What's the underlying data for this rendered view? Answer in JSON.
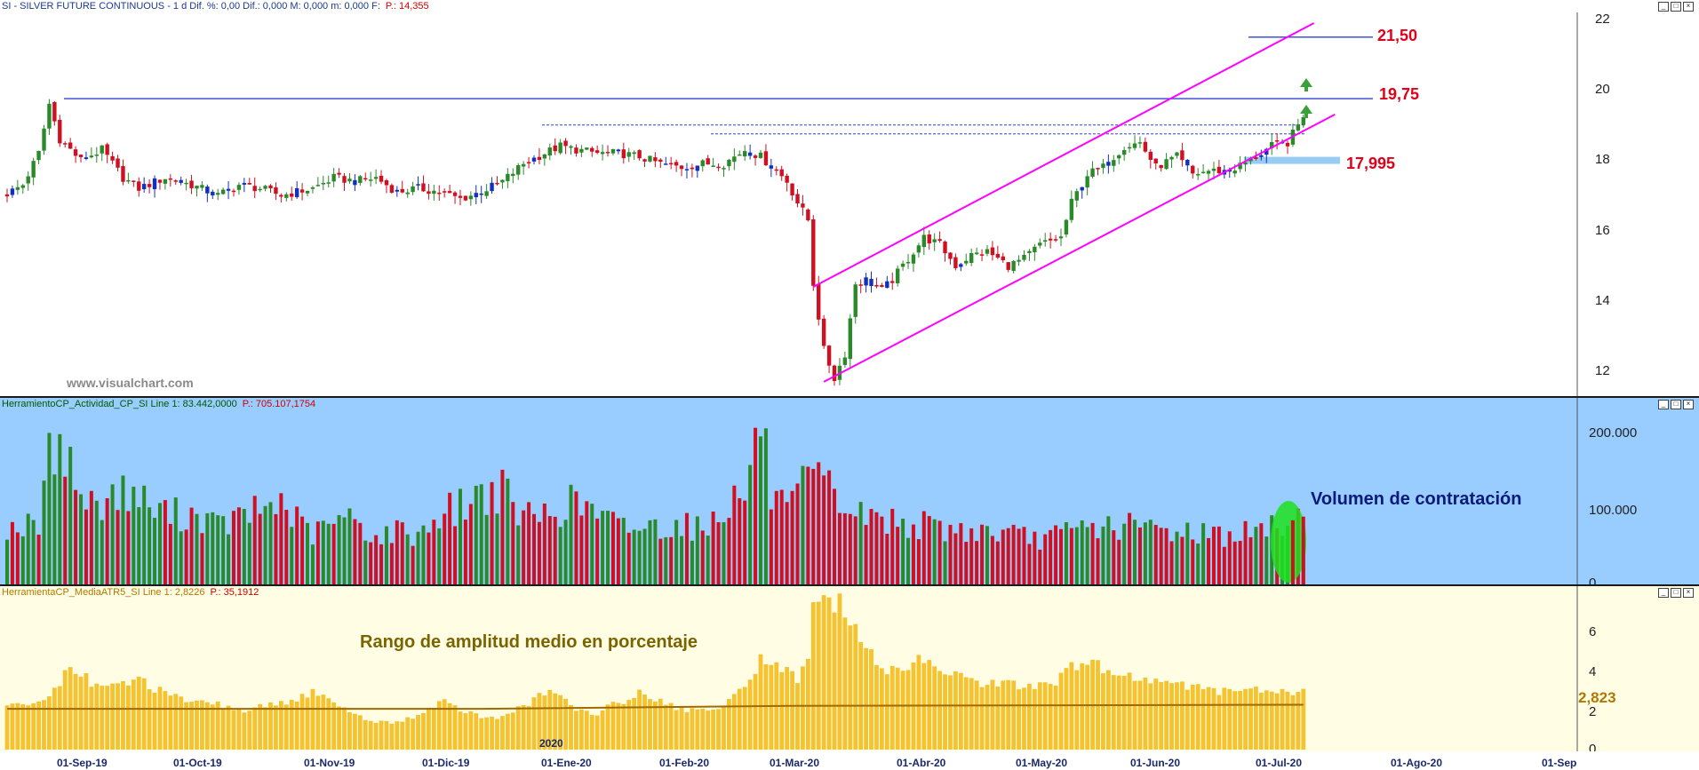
{
  "header": {
    "symbol_line": "SI - SILVER FUTURE CONTINUOUS -  1 d  Dif. %: 0,00  Dif.: 0,000  M: 0,000  m: 0,000  F:",
    "symbol_extra": "P.: 14,355"
  },
  "volume_panel": {
    "header": "HerramientoCP_Actividad_CP_SI  Line 1: 83.442,0000",
    "header_extra": "P.: 705.107,1754",
    "annotation": "Volumen de contratación",
    "axis": [
      "200.000",
      "100.000",
      "0"
    ]
  },
  "atr_panel": {
    "header": "HerramientaCP_MediaATR5_SI  Line 1: 2,8226",
    "header_extra": "P.: 35,1912",
    "annotation": "Rango de amplitud medio en porcentaje",
    "axis": [
      "6",
      "4",
      "2",
      "0"
    ],
    "last_value": "2,823"
  },
  "watermark": "www.visualchart.com",
  "price_axis": [
    "22",
    "20",
    "18",
    "16",
    "14",
    "12"
  ],
  "levels": {
    "resistance_high": "21,50",
    "resistance": "19,75",
    "support": "17,995"
  },
  "date_axis": [
    "01-Sep-19",
    "01-Oct-19",
    "01-Nov-19",
    "01-Dic-19",
    "01-Ene-20",
    "01-Feb-20",
    "01-Mar-20",
    "01-Abr-20",
    "01-May-20",
    "01-Jun-20",
    "01-Jul-20",
    "01-Ago-20",
    "01-Sep"
  ],
  "year_marker": "2020",
  "colors": {
    "up": "#2a8a2a",
    "down": "#d01020",
    "blue_candle": "#1030c0",
    "channel": "#ff00ff",
    "level_line": "#3040d0",
    "support_band": "#99ccf2",
    "atr_bar": "#f5c230",
    "atr_line": "#a06a00"
  },
  "chart_data": [
    {
      "type": "candlestick",
      "title": "SI - SILVER FUTURE CONTINUOUS",
      "ylim": [
        11.4,
        22.2
      ],
      "x": [
        "01-Sep-19",
        "01-Oct-19",
        "01-Nov-19",
        "01-Dic-19",
        "01-Ene-20",
        "01-Feb-20",
        "01-Mar-20",
        "01-Abr-20",
        "01-May-20",
        "01-Jun-20",
        "01-Jul-20"
      ],
      "close_path": [
        [
          0,
          17.05
        ],
        [
          3,
          17.3
        ],
        [
          6,
          18.2
        ],
        [
          8,
          19.6
        ],
        [
          10,
          18.6
        ],
        [
          14,
          18.0
        ],
        [
          18,
          18.3
        ],
        [
          22,
          17.5
        ],
        [
          25,
          17.2
        ],
        [
          30,
          17.5
        ],
        [
          35,
          17.3
        ],
        [
          40,
          17.0
        ],
        [
          44,
          17.3
        ],
        [
          48,
          17.2
        ],
        [
          52,
          17.0
        ],
        [
          58,
          17.2
        ],
        [
          62,
          17.5
        ],
        [
          66,
          17.4
        ],
        [
          70,
          17.5
        ],
        [
          74,
          17.1
        ],
        [
          78,
          17.2
        ],
        [
          82,
          17.1
        ],
        [
          86,
          16.9
        ],
        [
          90,
          17.1
        ],
        [
          94,
          17.4
        ],
        [
          98,
          17.9
        ],
        [
          102,
          18.2
        ],
        [
          105,
          18.4
        ],
        [
          108,
          18.3
        ],
        [
          112,
          18.2
        ],
        [
          116,
          18.2
        ],
        [
          120,
          18.1
        ],
        [
          124,
          17.9
        ],
        [
          128,
          17.8
        ],
        [
          132,
          17.9
        ],
        [
          136,
          17.9
        ],
        [
          140,
          18.3
        ],
        [
          143,
          18.1
        ],
        [
          146,
          17.7
        ],
        [
          148,
          17.4
        ],
        [
          150,
          16.8
        ],
        [
          152,
          16.3
        ],
        [
          153,
          14.5
        ],
        [
          155,
          12.6
        ],
        [
          157,
          11.8
        ],
        [
          159,
          12.5
        ],
        [
          161,
          14.5
        ],
        [
          163,
          14.6
        ],
        [
          166,
          14.3
        ],
        [
          168,
          14.6
        ],
        [
          171,
          15.2
        ],
        [
          174,
          15.8
        ],
        [
          177,
          15.6
        ],
        [
          180,
          15.0
        ],
        [
          183,
          15.3
        ],
        [
          186,
          15.4
        ],
        [
          190,
          15.0
        ],
        [
          193,
          15.2
        ],
        [
          196,
          15.6
        ],
        [
          200,
          15.8
        ],
        [
          202,
          16.8
        ],
        [
          205,
          17.6
        ],
        [
          208,
          17.8
        ],
        [
          212,
          18.4
        ],
        [
          215,
          18.5
        ],
        [
          218,
          17.8
        ],
        [
          222,
          18.1
        ],
        [
          225,
          17.6
        ],
        [
          228,
          17.7
        ],
        [
          232,
          17.7
        ],
        [
          236,
          18.0
        ],
        [
          240,
          18.4
        ],
        [
          243,
          18.5
        ],
        [
          245,
          19.0
        ],
        [
          246,
          19.3
        ]
      ],
      "levels": [
        21.5,
        19.75,
        17.995
      ],
      "dotted_levels": [
        18.9,
        19.0
      ],
      "channel_upper": [
        [
          153,
          14.4
        ],
        [
          248,
          21.9
        ]
      ],
      "channel_lower": [
        [
          155,
          11.7
        ],
        [
          252,
          19.3
        ]
      ]
    },
    {
      "type": "bar",
      "title": "Volumen de contratación",
      "ylim": [
        0,
        215000
      ],
      "values_path": [
        [
          0,
          70000
        ],
        [
          6,
          70000
        ],
        [
          8,
          150000
        ],
        [
          10,
          190000
        ],
        [
          13,
          120000
        ],
        [
          16,
          95000
        ],
        [
          20,
          110000
        ],
        [
          24,
          110000
        ],
        [
          28,
          90000
        ],
        [
          32,
          85000
        ],
        [
          36,
          85000
        ],
        [
          40,
          70000
        ],
        [
          44,
          80000
        ],
        [
          48,
          90000
        ],
        [
          52,
          100000
        ],
        [
          56,
          70000
        ],
        [
          58,
          60000
        ],
        [
          62,
          75000
        ],
        [
          66,
          80000
        ],
        [
          70,
          55000
        ],
        [
          74,
          65000
        ],
        [
          78,
          60000
        ],
        [
          82,
          85000
        ],
        [
          86,
          95000
        ],
        [
          90,
          110000
        ],
        [
          94,
          115000
        ],
        [
          96,
          90000
        ],
        [
          100,
          80000
        ],
        [
          104,
          90000
        ],
        [
          108,
          100000
        ],
        [
          112,
          85000
        ],
        [
          116,
          70000
        ],
        [
          120,
          70000
        ],
        [
          124,
          70000
        ],
        [
          128,
          75000
        ],
        [
          132,
          65000
        ],
        [
          136,
          95000
        ],
        [
          140,
          110000
        ],
        [
          143,
          200000
        ],
        [
          145,
          110000
        ],
        [
          148,
          85000
        ],
        [
          150,
          100000
        ],
        [
          152,
          130000
        ],
        [
          155,
          120000
        ],
        [
          158,
          100000
        ],
        [
          161,
          85000
        ],
        [
          165,
          80000
        ],
        [
          170,
          75000
        ],
        [
          175,
          70000
        ],
        [
          180,
          65000
        ],
        [
          185,
          65000
        ],
        [
          190,
          60000
        ],
        [
          195,
          55000
        ],
        [
          200,
          60000
        ],
        [
          205,
          70000
        ],
        [
          210,
          70000
        ],
        [
          215,
          70000
        ],
        [
          220,
          65000
        ],
        [
          225,
          65000
        ],
        [
          230,
          60000
        ],
        [
          235,
          62000
        ],
        [
          240,
          68000
        ],
        [
          243,
          75000
        ],
        [
          246,
          82000
        ]
      ],
      "highlight_bars": [
        244,
        246
      ]
    },
    {
      "type": "bar",
      "title": "Rango de amplitud medio en porcentaje",
      "ylim": [
        0,
        7.5
      ],
      "values_path": [
        [
          0,
          2.1
        ],
        [
          6,
          2.3
        ],
        [
          10,
          3.2
        ],
        [
          12,
          4.3
        ],
        [
          15,
          3.5
        ],
        [
          18,
          3.0
        ],
        [
          22,
          3.2
        ],
        [
          25,
          3.5
        ],
        [
          30,
          2.7
        ],
        [
          35,
          2.3
        ],
        [
          40,
          2.2
        ],
        [
          45,
          1.9
        ],
        [
          50,
          2.2
        ],
        [
          55,
          2.5
        ],
        [
          58,
          2.8
        ],
        [
          62,
          2.4
        ],
        [
          65,
          1.7
        ],
        [
          70,
          1.4
        ],
        [
          74,
          1.3
        ],
        [
          78,
          1.7
        ],
        [
          82,
          2.4
        ],
        [
          86,
          2.0
        ],
        [
          90,
          1.6
        ],
        [
          94,
          1.6
        ],
        [
          98,
          2.1
        ],
        [
          102,
          2.8
        ],
        [
          104,
          2.7
        ],
        [
          108,
          2.0
        ],
        [
          112,
          1.8
        ],
        [
          116,
          2.3
        ],
        [
          120,
          2.8
        ],
        [
          124,
          2.4
        ],
        [
          128,
          2.0
        ],
        [
          132,
          1.9
        ],
        [
          136,
          2.2
        ],
        [
          140,
          3.0
        ],
        [
          143,
          4.5
        ],
        [
          146,
          4.2
        ],
        [
          150,
          3.5
        ],
        [
          152,
          4.6
        ],
        [
          153,
          7.3
        ],
        [
          158,
          7.3
        ],
        [
          160,
          6.2
        ],
        [
          163,
          5.0
        ],
        [
          166,
          3.7
        ],
        [
          170,
          4.0
        ],
        [
          174,
          4.5
        ],
        [
          178,
          4.0
        ],
        [
          182,
          3.5
        ],
        [
          186,
          3.2
        ],
        [
          190,
          3.3
        ],
        [
          194,
          3.1
        ],
        [
          198,
          3.1
        ],
        [
          202,
          4.0
        ],
        [
          206,
          4.3
        ],
        [
          210,
          3.6
        ],
        [
          214,
          3.5
        ],
        [
          218,
          3.4
        ],
        [
          222,
          3.3
        ],
        [
          226,
          3.0
        ],
        [
          230,
          2.9
        ],
        [
          234,
          3.0
        ],
        [
          238,
          3.0
        ],
        [
          242,
          2.9
        ],
        [
          246,
          2.8
        ]
      ],
      "average_line": [
        [
          0,
          2.0
        ],
        [
          90,
          2.0
        ],
        [
          150,
          2.15
        ],
        [
          246,
          2.2
        ]
      ]
    }
  ]
}
